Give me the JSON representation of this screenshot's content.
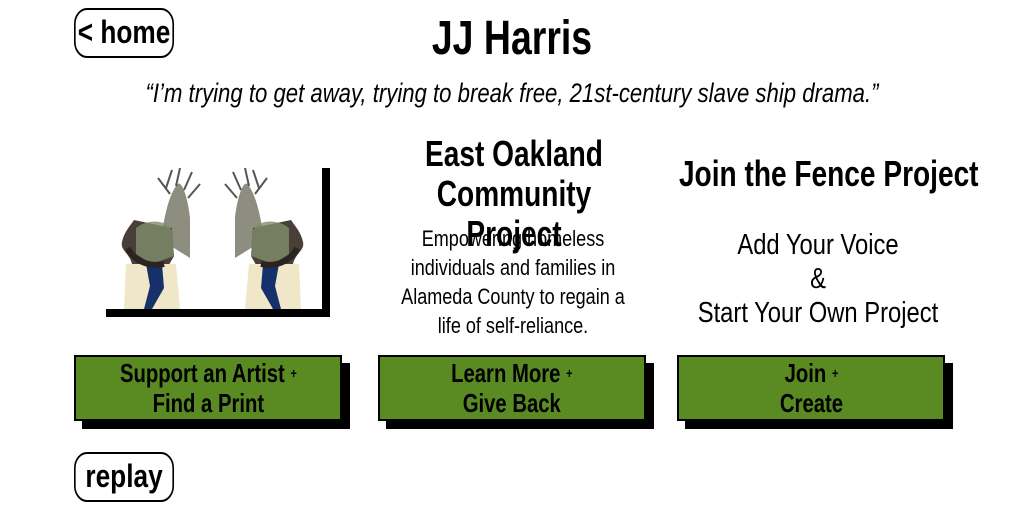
{
  "nav": {
    "home_label": "< home",
    "replay_label": "replay"
  },
  "header": {
    "title": "JJ Harris",
    "quote": "“I’m trying to get away, trying to break free, 21st-century slave ship drama.”"
  },
  "columns": [
    {
      "title_line1": "East Oakland",
      "title_line2": "Community Project",
      "body_line1": "Empowering homeless",
      "body_line2": "individuals and families in",
      "body_line3": "Alameda County to regain a",
      "body_line4": "life of self-reliance."
    },
    {
      "title": "Join the Fence Project",
      "body_line1": "Add Your Voice",
      "body_line2": "&",
      "body_line3": "Start Your Own Project"
    }
  ],
  "buttons": [
    {
      "line1": "Support an Artist",
      "line2": "Find a Print"
    },
    {
      "line1": "Learn More",
      "line2": "Give Back"
    },
    {
      "line1": "Join",
      "line2": "Create"
    }
  ],
  "plus_symbol": "+",
  "colors": {
    "button_green": "#5a8a22",
    "background": "#ffffff",
    "ink": "#000000"
  }
}
